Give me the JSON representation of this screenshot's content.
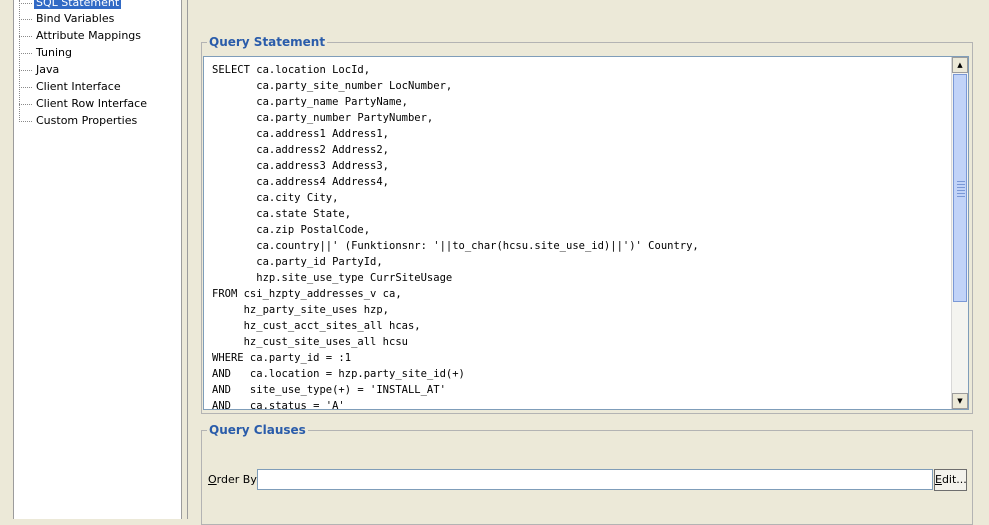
{
  "nav": {
    "items": [
      {
        "label": "SQL Statement",
        "selected": true
      },
      {
        "label": "Bind Variables",
        "selected": false
      },
      {
        "label": "Attribute Mappings",
        "selected": false
      },
      {
        "label": "Tuning",
        "selected": false
      },
      {
        "label": "Java",
        "selected": false
      },
      {
        "label": "Client Interface",
        "selected": false
      },
      {
        "label": "Client Row Interface",
        "selected": false
      },
      {
        "label": "Custom Properties",
        "selected": false
      }
    ]
  },
  "query_statement": {
    "title": "Query Statement",
    "sql": "SELECT ca.location LocId,\n       ca.party_site_number LocNumber,\n       ca.party_name PartyName,\n       ca.party_number PartyNumber,\n       ca.address1 Address1,\n       ca.address2 Address2,\n       ca.address3 Address3,\n       ca.address4 Address4,\n       ca.city City,\n       ca.state State,\n       ca.zip PostalCode,\n       ca.country||' (Funktionsnr: '||to_char(hcsu.site_use_id)||')' Country,\n       ca.party_id PartyId,\n       hzp.site_use_type CurrSiteUsage\nFROM csi_hzpty_addresses_v ca,\n     hz_party_site_uses hzp,\n     hz_cust_acct_sites_all hcas,\n     hz_cust_site_uses_all hcsu\nWHERE ca.party_id = :1\nAND   ca.location = hzp.party_site_id(+)\nAND   site_use_type(+) = 'INSTALL_AT'\nAND   ca.status = 'A'",
    "scroll_position": 0
  },
  "query_clauses": {
    "title": "Query Clauses",
    "order_by_label_accel": "O",
    "order_by_label_rest": "rder By:",
    "order_by_value": "",
    "edit_button_accel": "E",
    "edit_button_rest": "dit..."
  },
  "colors": {
    "group_title": "#2a5caa",
    "selection": "#316ac5",
    "scroll_thumb": "#c1d3f8"
  }
}
